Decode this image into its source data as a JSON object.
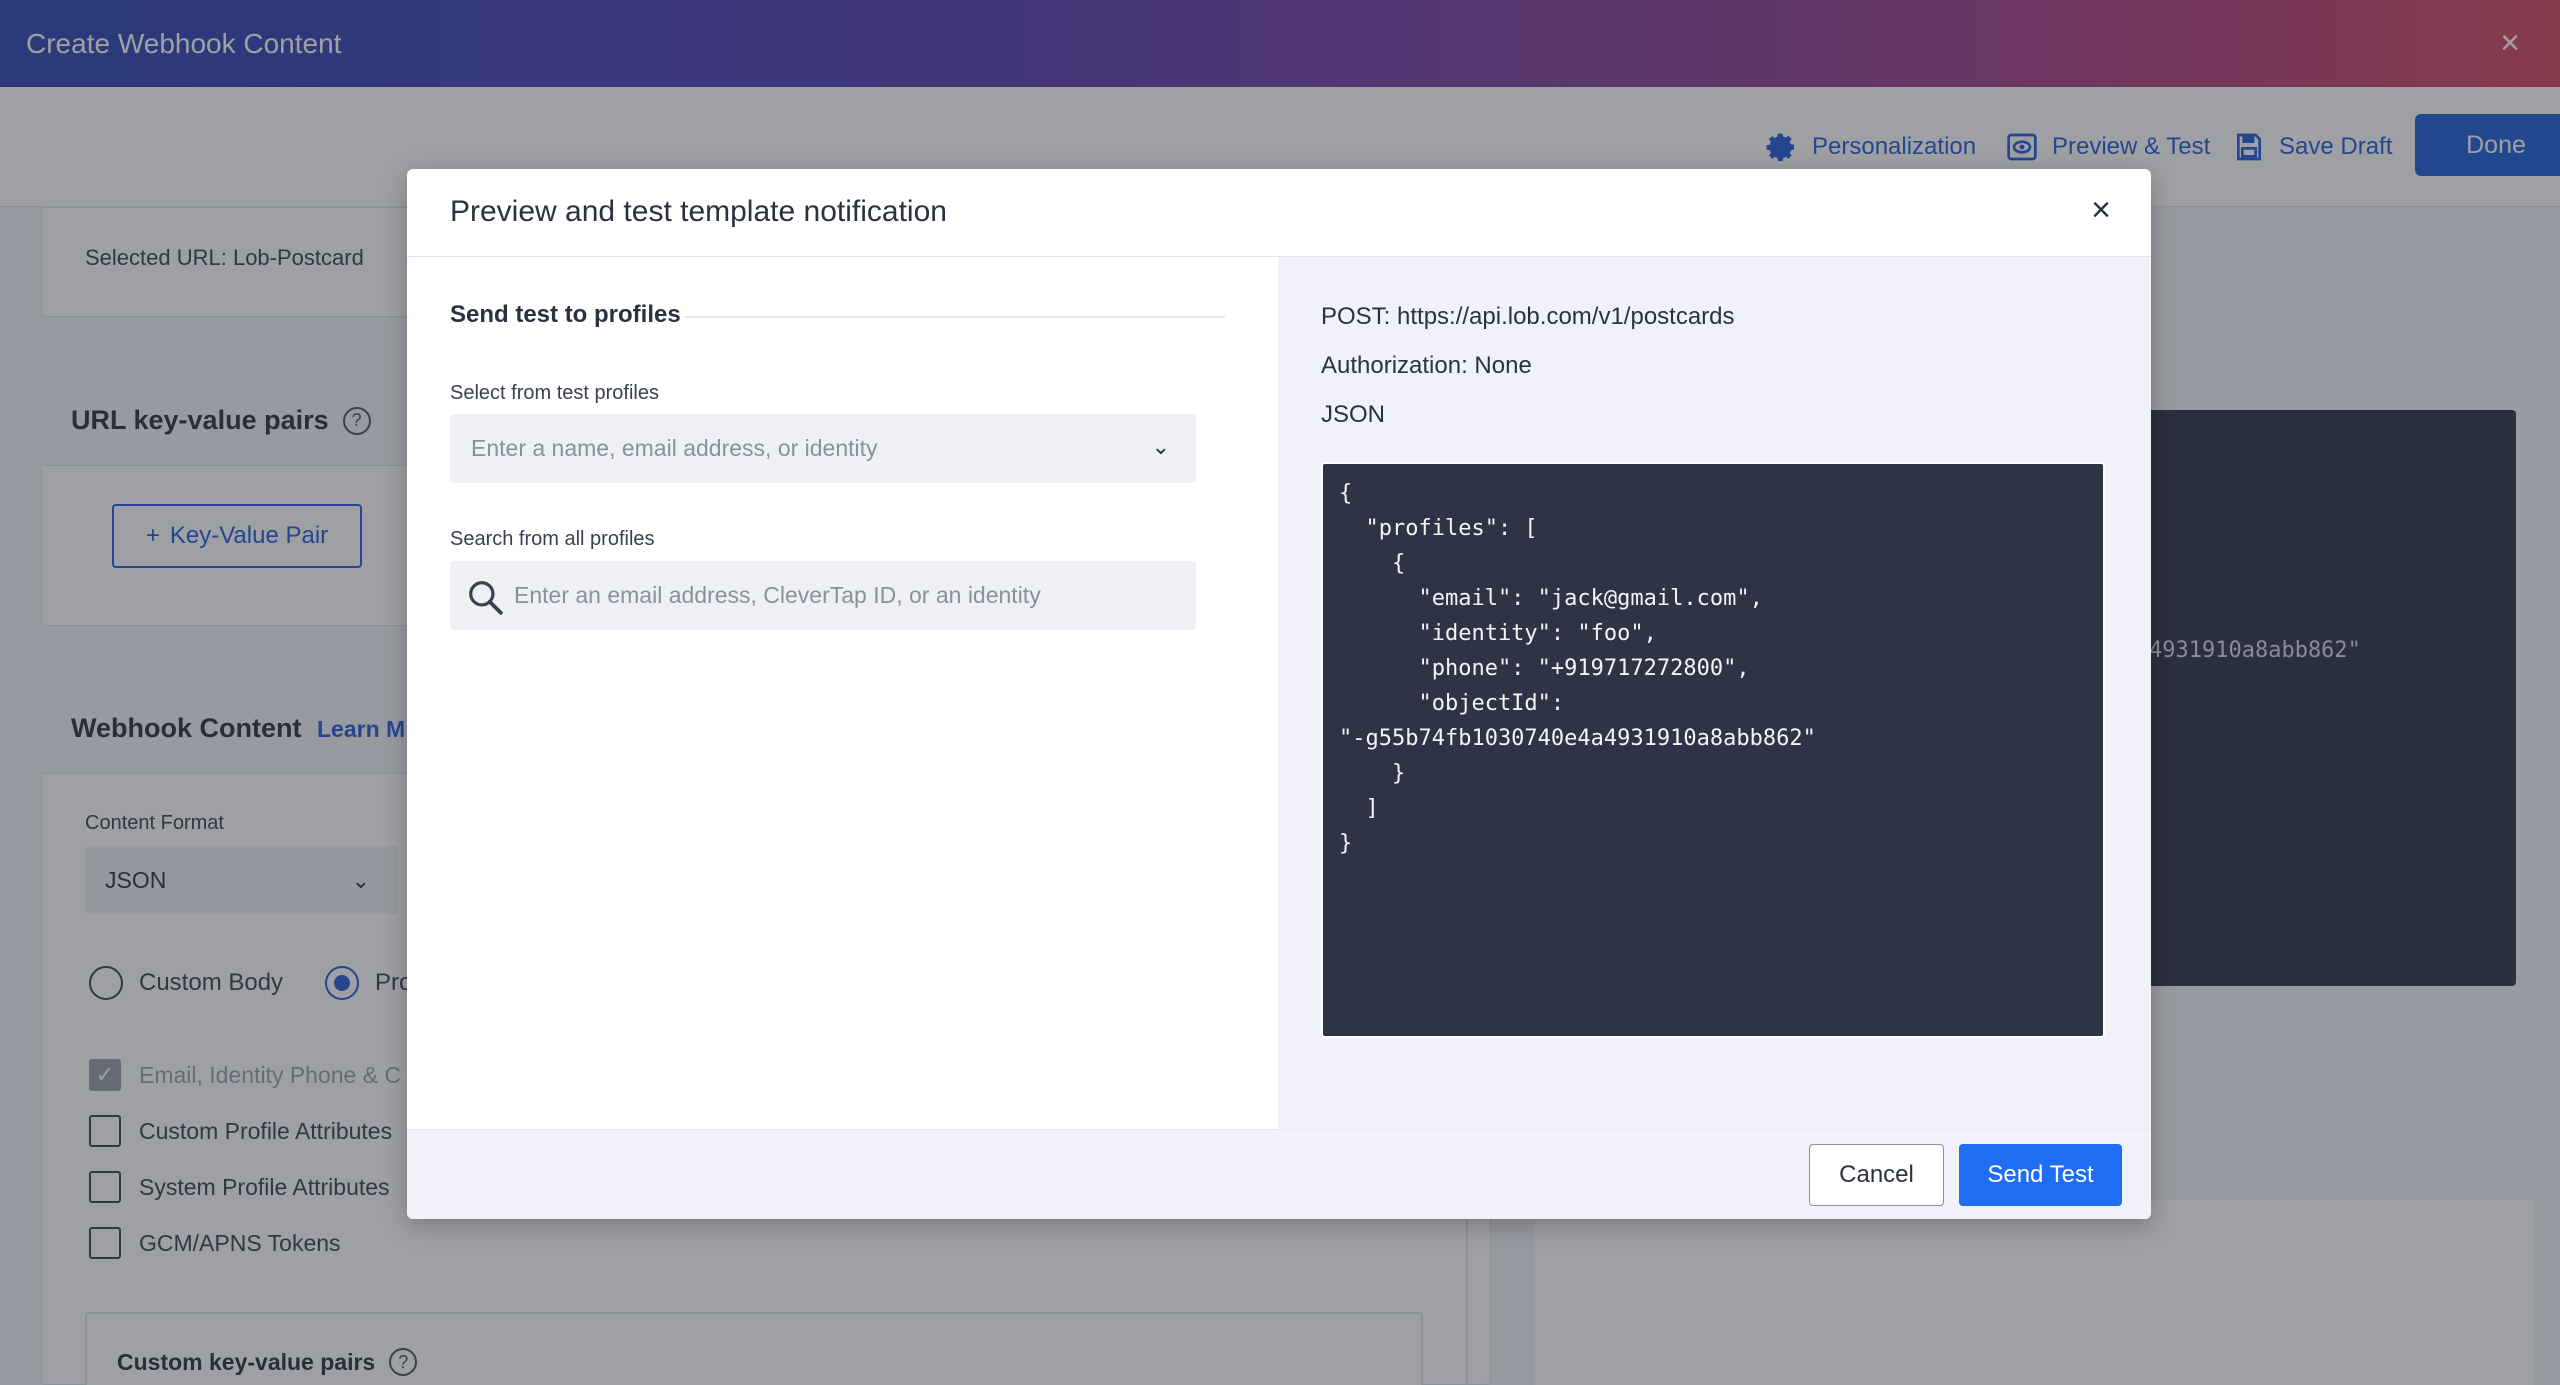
{
  "window": {
    "title": "Create Webhook Content",
    "close_icon": "×"
  },
  "toolbar": {
    "personalization": "Personalization",
    "preview_test": "Preview & Test",
    "save_draft": "Save Draft",
    "done": "Done"
  },
  "background": {
    "selected_url": "Selected URL: Lob-Postcard",
    "url_kv_title": "URL key-value pairs",
    "help_glyph": "?",
    "kv_button": "Key-Value Pair",
    "kv_button_plus": "+",
    "webhook_title": "Webhook Content",
    "learn_more": "Learn M",
    "content_format_label": "Content Format",
    "content_format_value": "JSON",
    "radio_custom_body": "Custom Body",
    "radio_profile": "Pro",
    "checkboxes": [
      {
        "label": "Email, Identity Phone & C",
        "checked": true,
        "disabled": true
      },
      {
        "label": "Custom Profile Attributes",
        "checked": false,
        "disabled": false
      },
      {
        "label": "System Profile Attributes",
        "checked": false,
        "disabled": false
      },
      {
        "label": "GCM/APNS Tokens",
        "checked": false,
        "disabled": false
      }
    ],
    "custom_kv_title": "Custom key-value pairs",
    "code_fragment": "4931910a8abb862\""
  },
  "modal": {
    "title": "Preview and test template notification",
    "close_icon": "×",
    "send_section_title": "Send test to profiles",
    "select_label": "Select from test profiles",
    "select_placeholder": "Enter a name, email address, or identity",
    "search_label": "Search from all profiles",
    "search_placeholder": "Enter an email address, CleverTap ID, or an identity",
    "request_line": "POST: https://api.lob.com/v1/postcards",
    "authorization": "Authorization: None",
    "format": "JSON",
    "code_lines": [
      "{",
      "  \"profiles\": [",
      "    {",
      "      \"email\": \"jack@gmail.com\",",
      "      \"identity\": \"foo\",",
      "      \"phone\": \"+919717272800\",",
      "      \"objectId\":",
      "\"-g55b74fb1030740e4a4931910a8abb862\"",
      "    }",
      "  ]",
      "}"
    ],
    "cancel": "Cancel",
    "send_test": "Send Test"
  },
  "colors": {
    "accent": "#1f6df2",
    "link": "#2459d9",
    "code_bg": "#2e3445"
  }
}
